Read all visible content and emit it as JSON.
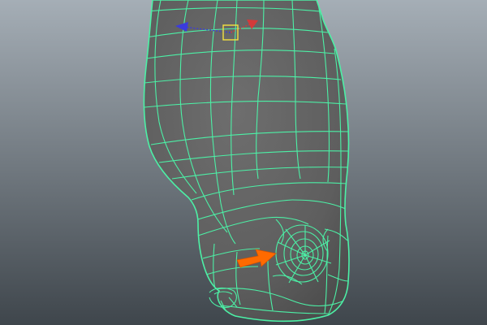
{
  "viewport": {
    "panel": "perspective-viewport",
    "background_top": "#a5aeb6",
    "background_bottom": "#3f464c",
    "shading_mode": "wireframe-on-shaded",
    "selection_mode": "object"
  },
  "model": {
    "object": "polygon-mesh",
    "surface_color": "#646464",
    "wireframe_color": "#4cf0a6",
    "highlighted": true
  },
  "manipulator": {
    "tool": "move-tool",
    "x_axis_color": "#d43a3a",
    "z_axis_color": "#3b3bdc",
    "center_color": "#f4e23e"
  },
  "annotation": {
    "icon": "arrow-icon",
    "color": "#ff6a00"
  }
}
